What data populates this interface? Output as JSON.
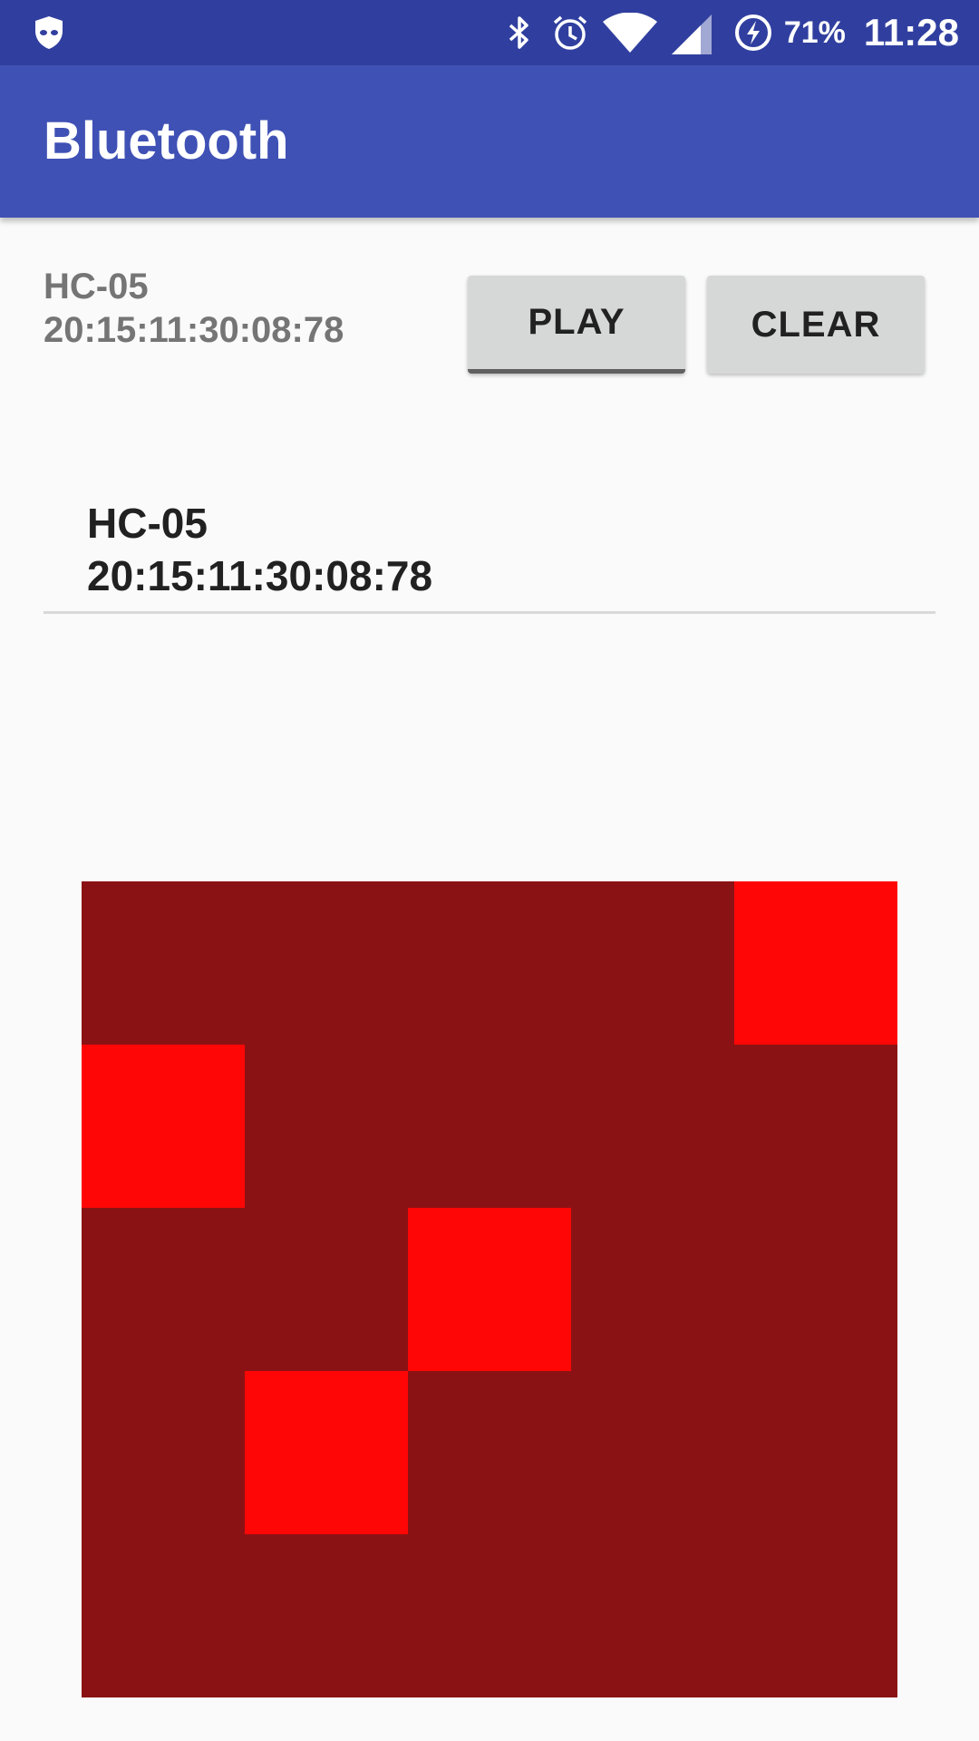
{
  "status_bar": {
    "left_icon": "shield-face-icon",
    "icons": [
      "bluetooth-icon",
      "alarm-icon",
      "wifi-icon",
      "signal-icon",
      "battery-charging-icon"
    ],
    "battery": "71%",
    "time": "11:28"
  },
  "app_bar": {
    "title": "Bluetooth",
    "color": "#3f51b5",
    "status_color": "#303f9f"
  },
  "device": {
    "name": "HC-05",
    "address": "20:15:11:30:08:78"
  },
  "buttons": {
    "play": "PLAY",
    "clear": "CLEAR"
  },
  "devices_list": [
    {
      "name": "HC-05",
      "address": "20:15:11:30:08:78"
    }
  ],
  "grid": {
    "rows": 5,
    "cols": 5,
    "off_color": "#8b1214",
    "on_color": "#ff0606",
    "on_cells": [
      [
        0,
        4
      ],
      [
        1,
        0
      ],
      [
        2,
        2
      ],
      [
        3,
        1
      ]
    ]
  }
}
